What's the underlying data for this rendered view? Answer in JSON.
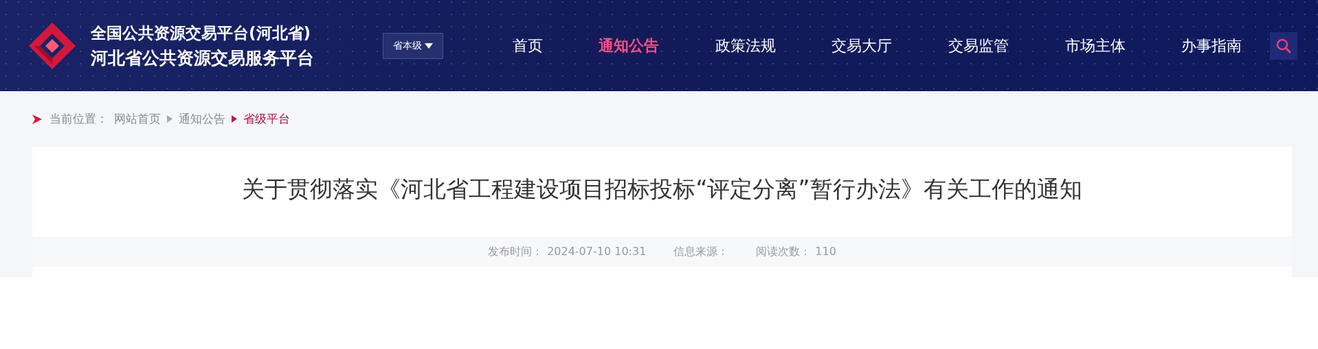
{
  "header": {
    "title_line1": "全国公共资源交易平台(河北省)",
    "title_line2": "河北省公共资源交易服务平台",
    "level_dropdown": "省本级",
    "nav": [
      {
        "label": "首页",
        "selected": false
      },
      {
        "label": "通知公告",
        "selected": true
      },
      {
        "label": "政策法规",
        "selected": false
      },
      {
        "label": "交易大厅",
        "selected": false
      },
      {
        "label": "交易监管",
        "selected": false
      },
      {
        "label": "市场主体",
        "selected": false
      },
      {
        "label": "办事指南",
        "selected": false
      }
    ]
  },
  "breadcrumb": {
    "label": "当前位置：",
    "items": [
      {
        "label": "网站首页",
        "selected": false
      },
      {
        "label": "通知公告",
        "selected": false
      },
      {
        "label": "省级平台",
        "selected": true
      }
    ]
  },
  "article": {
    "title": "关于贯彻落实《河北省工程建设项目招标投标“评定分离”暂行办法》有关工作的通知",
    "meta": [
      {
        "label": "发布时间：",
        "value": "2024-07-10 10:31"
      },
      {
        "label": "信息来源："
      },
      {
        "label": "阅读次数：",
        "value": "110"
      }
    ]
  }
}
